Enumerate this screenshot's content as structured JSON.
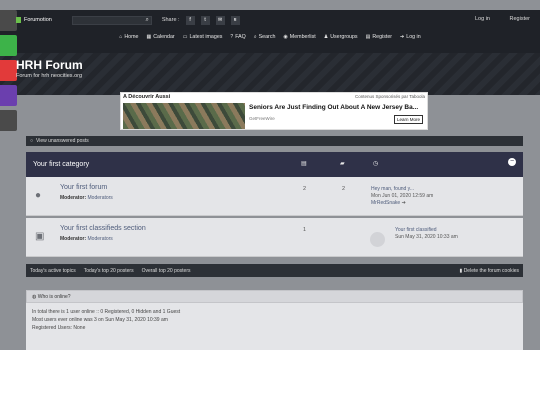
{
  "topnav": {
    "brand": "Forumotion",
    "share_label": "Share :",
    "social_icons": [
      "facebook-icon",
      "twitter-icon",
      "email-icon",
      "rss-icon"
    ],
    "social_glyphs": [
      "f",
      "t",
      "✉",
      "ʀ"
    ],
    "login": "Log in",
    "register": "Register"
  },
  "mainnav": {
    "items": [
      {
        "label": "Home",
        "icon": "home-icon",
        "glyph": "⌂"
      },
      {
        "label": "Calendar",
        "icon": "calendar-icon",
        "glyph": "▦"
      },
      {
        "label": "Latest images",
        "icon": "image-icon",
        "glyph": "▭"
      },
      {
        "label": "FAQ",
        "icon": "help-icon",
        "glyph": "?"
      },
      {
        "label": "Search",
        "icon": "search-icon",
        "glyph": "⌕"
      },
      {
        "label": "Memberlist",
        "icon": "members-icon",
        "glyph": "◉"
      },
      {
        "label": "Usergroups",
        "icon": "groups-icon",
        "glyph": "♟"
      },
      {
        "label": "Register",
        "icon": "register-icon",
        "glyph": "▤"
      },
      {
        "label": "Log in",
        "icon": "login-icon",
        "glyph": "➔"
      }
    ]
  },
  "site": {
    "title": "HRH Forum",
    "description": "Forum for hrh neocities.org"
  },
  "side_tabs": {
    "colors": [
      "#4a4a4a",
      "#3db349",
      "#e23a3a",
      "#6b3fae",
      "#4a4a4a"
    ]
  },
  "ad": {
    "header_left": "A Découvrir Aussi",
    "header_right": "Contenus Sponsorisés par Taboola",
    "headline": "Seniors Are Just Finding Out About A New Jersey Ba...",
    "source": "GetFreeWire",
    "button": "Learn More"
  },
  "unanswered_link": "View unanswered posts",
  "category": {
    "title": "Your first category",
    "collapse": "−"
  },
  "forums": [
    {
      "name": "Your first forum",
      "moderator_label": "Moderator:",
      "moderator": "Moderators",
      "topics": "2",
      "posts": "2",
      "last_title": "Hey man, found y...",
      "last_date": "Mon Jun 01, 2020 12:59 am",
      "last_user": "MrRedSnake"
    },
    {
      "name": "Your first classifieds section",
      "moderator_label": "Moderator:",
      "moderator": "Moderators",
      "topics": "1",
      "last_title": "Your first classified",
      "last_date": "Sun May 31, 2020 10:33 am"
    }
  ],
  "footer_links": {
    "active": "Today's active topics",
    "top20": "Today's top 20 posters",
    "overall": "Overall top 20 posters",
    "delete_cookies": "Delete the forum cookies"
  },
  "online": {
    "title": "Who is online?",
    "line1": "In total there is 1 user online :: 0 Registered, 0 Hidden and 1 Guest",
    "line2": "Most users ever online was 3 on Sun May 31, 2020 10:39 am",
    "line3": "Registered Users: None"
  }
}
